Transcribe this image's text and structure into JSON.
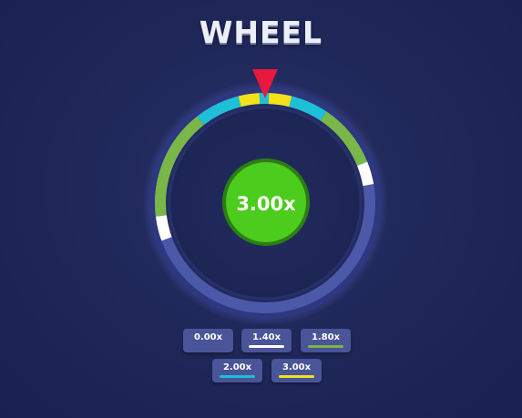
{
  "title": "WHEEL",
  "center_value": "3.00x",
  "colors": {
    "track": "#4c58a8",
    "segment_white": "#ffffff",
    "segment_green": "#7ab648",
    "segment_cyan": "#1ec0d8",
    "segment_yellow": "#f2e21a",
    "pointer": "#e8193c",
    "center_fill": "#4ccc1c",
    "center_stroke": "#2c7d14"
  },
  "wheel_segments": [
    {
      "multiplier": "1.40x",
      "color": "#ffffff",
      "start_deg": -110,
      "end_deg": -97
    },
    {
      "multiplier": "1.80x",
      "color": "#7ab648",
      "start_deg": -97,
      "end_deg": -38
    },
    {
      "multiplier": "2.00x",
      "color": "#1ec0d8",
      "start_deg": -38,
      "end_deg": -14
    },
    {
      "multiplier": "3.00x",
      "color": "#f2e21a",
      "start_deg": -14,
      "end_deg": -3
    },
    {
      "multiplier": "2.00x",
      "color": "#1ec0d8",
      "start_deg": -3,
      "end_deg": 2
    },
    {
      "multiplier": "3.00x",
      "color": "#f2e21a",
      "start_deg": 2,
      "end_deg": 14
    },
    {
      "multiplier": "2.00x",
      "color": "#1ec0d8",
      "start_deg": 14,
      "end_deg": 34
    },
    {
      "multiplier": "1.80x",
      "color": "#7ab648",
      "start_deg": 34,
      "end_deg": 68
    },
    {
      "multiplier": "1.40x",
      "color": "#ffffff",
      "start_deg": 68,
      "end_deg": 80
    }
  ],
  "legend": [
    {
      "label": "0.00x",
      "color": "#4a5499"
    },
    {
      "label": "1.40x",
      "color": "#ffffff"
    },
    {
      "label": "1.80x",
      "color": "#7ab648"
    },
    {
      "label": "2.00x",
      "color": "#1ec0d8"
    },
    {
      "label": "3.00x",
      "color": "#f2e21a"
    }
  ]
}
